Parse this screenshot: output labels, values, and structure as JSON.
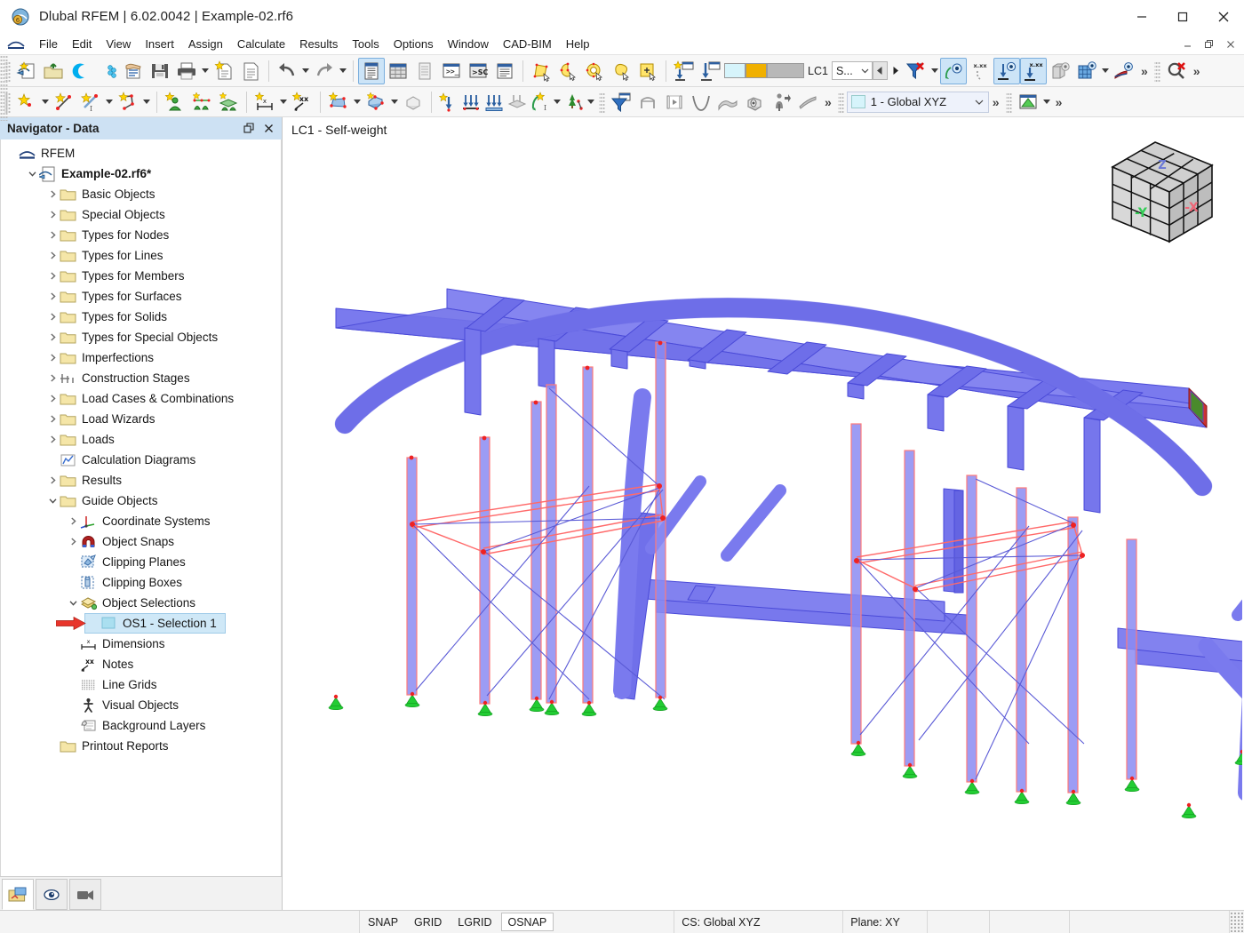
{
  "window": {
    "title": "Dlubal RFEM | 6.02.0042 | Example-02.rf6",
    "app_icon": "rfem-app-icon",
    "minimize": "minimize-icon",
    "maximize": "maximize-icon",
    "close": "close-icon"
  },
  "menubar": {
    "items": [
      {
        "label": "File"
      },
      {
        "label": "Edit"
      },
      {
        "label": "View"
      },
      {
        "label": "Insert"
      },
      {
        "label": "Assign"
      },
      {
        "label": "Calculate"
      },
      {
        "label": "Results"
      },
      {
        "label": "Tools"
      },
      {
        "label": "Options"
      },
      {
        "label": "Window"
      },
      {
        "label": "CAD-BIM"
      },
      {
        "label": "Help"
      }
    ]
  },
  "toolbar1": {
    "buttons": [
      {
        "name": "new-model-button",
        "icon": "new-model-icon"
      },
      {
        "name": "open-button",
        "icon": "open-folder-icon"
      },
      {
        "name": "dlubal-center-button",
        "icon": "dlubal-c-icon"
      },
      {
        "name": "model-library-button",
        "icon": "blue-cube-icon"
      },
      {
        "name": "model-info-button",
        "icon": "hand-list-icon"
      },
      {
        "name": "save-button",
        "icon": "floppy-save-icon"
      },
      {
        "name": "print-button",
        "icon": "printer-icon",
        "dropdown": true
      },
      {
        "name": "new-report-button",
        "icon": "new-document-star-icon"
      },
      {
        "name": "document-button",
        "icon": "document-icon"
      }
    ],
    "undo": {
      "name": "undo-button",
      "icon": "undo-arrow-icon",
      "dropdown": true
    },
    "redo": {
      "name": "redo-button",
      "icon": "redo-arrow-icon",
      "dropdown": true
    },
    "tables": [
      {
        "name": "navigator-table-button",
        "icon": "table-list-icon",
        "active": true
      },
      {
        "name": "spreadsheet-button",
        "icon": "grid-table-icon"
      },
      {
        "name": "printout-table-button",
        "icon": "printout-table-icon"
      },
      {
        "name": "console-button",
        "icon": "console-prompt-icon"
      },
      {
        "name": "script-button",
        "icon": "script-sc-icon"
      },
      {
        "name": "detail-table-button",
        "icon": "detail-table-icon"
      }
    ],
    "selection": [
      {
        "name": "select-objects-button",
        "icon": "select-polygon-icon"
      },
      {
        "name": "select-special-button",
        "icon": "select-lasso-icon"
      },
      {
        "name": "select-all-button",
        "icon": "select-circle-icon"
      },
      {
        "name": "deselect-button",
        "icon": "lasso-cursor-icon"
      },
      {
        "name": "add-to-selection-button",
        "icon": "plus-selection-icon"
      }
    ],
    "loads": [
      {
        "name": "new-load-case-button",
        "icon": "new-load-case-icon"
      },
      {
        "name": "load-import-button",
        "icon": "load-import-icon"
      }
    ],
    "lc_swatch1": "#d6f4fb",
    "lc_swatch2": "#f0b000",
    "lc_swatch3": "#b8b8b8",
    "lc_label": "LC1",
    "lc_combo_value": "S...",
    "prev_lc": "prev-load-case-arrow",
    "next_lc": "next-load-case-arrow",
    "view_tools": [
      {
        "name": "filter-off-button",
        "icon": "filter-red-x-icon",
        "dropdown": true
      },
      {
        "name": "show-numbering-button",
        "icon": "eye-numbering-icon",
        "active": true
      },
      {
        "name": "hide-values-button",
        "icon": "xxx-hidden-icon"
      },
      {
        "name": "show-supports-button",
        "icon": "eye-support-icon",
        "active": true
      },
      {
        "name": "show-support-values-button",
        "icon": "xxx-support-icon",
        "active": true
      },
      {
        "name": "show-solids-button",
        "icon": "eye-solid-icon"
      },
      {
        "name": "show-grid-button",
        "icon": "eye-grid-icon",
        "dropdown": true
      },
      {
        "name": "show-results-button",
        "icon": "eye-results-icon"
      }
    ],
    "overflow": "chevron-more-icon",
    "zoom_reset": {
      "name": "zoom-reset-button",
      "icon": "magnifier-red-x-icon"
    },
    "overflow2": "chevron-more-icon"
  },
  "toolbar2": {
    "group_nodes": [
      {
        "name": "new-node-button",
        "icon": "node-star-icon",
        "dropdown": true
      },
      {
        "name": "new-line-button",
        "icon": "line-star-icon"
      },
      {
        "name": "new-line-type-button",
        "icon": "line-type-star-icon",
        "dropdown": true
      },
      {
        "name": "new-polyline-button",
        "icon": "polyline-star-icon",
        "dropdown": true
      }
    ],
    "group_supports": [
      {
        "name": "new-nodal-support-button",
        "icon": "nodal-support-icon"
      },
      {
        "name": "new-line-support-button",
        "icon": "line-support-icon"
      },
      {
        "name": "new-surface-support-button",
        "icon": "surface-support-icon"
      }
    ],
    "group_dims": [
      {
        "name": "new-dimension-button",
        "icon": "dimension-x-icon",
        "dropdown": true
      },
      {
        "name": "new-note-button",
        "icon": "note-xx-icon"
      }
    ],
    "group_surfaces": [
      {
        "name": "new-surface-button",
        "icon": "surface-star-icon",
        "dropdown": true
      },
      {
        "name": "new-solid-button",
        "icon": "solid-star-icon",
        "dropdown": true
      },
      {
        "name": "new-opening-button",
        "icon": "opening-star-icon",
        "dropdown": true
      },
      {
        "name": "new-member-button",
        "icon": "member-star-icon",
        "dropdown": true
      },
      {
        "name": "new-block-button",
        "icon": "block-icon"
      }
    ],
    "group_loads": [
      {
        "name": "new-nodal-load-button",
        "icon": "nodal-load-icon"
      },
      {
        "name": "new-member-load-button",
        "icon": "member-load-icon"
      },
      {
        "name": "new-line-load-button",
        "icon": "line-load-icon"
      },
      {
        "name": "new-surface-load-button",
        "icon": "surface-load-icon"
      },
      {
        "name": "new-free-load-button",
        "icon": "free-load-icon",
        "dropdown": true
      },
      {
        "name": "new-imperfection-button",
        "icon": "imperfection-icon",
        "dropdown": true
      }
    ],
    "group_render": [
      {
        "name": "render-filter-button",
        "icon": "blue-funnel-window-icon"
      },
      {
        "name": "rendering-mode-button",
        "icon": "wireframe-icon"
      },
      {
        "name": "animation-button",
        "icon": "film-strip-icon"
      },
      {
        "name": "deformation-button",
        "icon": "deformation-curve-icon"
      },
      {
        "name": "surface-results-button",
        "icon": "surface-results-icon"
      },
      {
        "name": "solid-results-button",
        "icon": "solid-results-icon"
      },
      {
        "name": "support-reactions-button",
        "icon": "support-reaction-icon"
      },
      {
        "name": "slab-results-button",
        "icon": "slab-results-icon"
      }
    ],
    "overflow": "chevron-more-icon",
    "cs_swatch": "#d6f4fb",
    "cs_value": "1 - Global XYZ",
    "cs_dropdown": "chevron-down-icon",
    "overflow2": "chevron-more-icon",
    "graphic_button": {
      "name": "graphic-settings-button",
      "icon": "green-graphic-icon",
      "dropdown": true
    },
    "overflow3": "chevron-more-icon"
  },
  "navigator": {
    "title": "Navigator - Data",
    "undock_icon": "undock-icon",
    "close_icon": "close-icon",
    "tree": [
      {
        "label": "RFEM",
        "indent": 0,
        "twist": "none",
        "icon": "rfem-root-icon",
        "bold": false
      },
      {
        "label": "Example-02.rf6*",
        "indent": 1,
        "twist": "open",
        "icon": "model-file-icon",
        "bold": true
      },
      {
        "label": "Basic Objects",
        "indent": 2,
        "twist": "closed",
        "icon": "folder-icon"
      },
      {
        "label": "Special Objects",
        "indent": 2,
        "twist": "closed",
        "icon": "folder-icon"
      },
      {
        "label": "Types for Nodes",
        "indent": 2,
        "twist": "closed",
        "icon": "folder-icon"
      },
      {
        "label": "Types for Lines",
        "indent": 2,
        "twist": "closed",
        "icon": "folder-icon"
      },
      {
        "label": "Types for Members",
        "indent": 2,
        "twist": "closed",
        "icon": "folder-icon"
      },
      {
        "label": "Types for Surfaces",
        "indent": 2,
        "twist": "closed",
        "icon": "folder-icon"
      },
      {
        "label": "Types for Solids",
        "indent": 2,
        "twist": "closed",
        "icon": "folder-icon"
      },
      {
        "label": "Types for Special Objects",
        "indent": 2,
        "twist": "closed",
        "icon": "folder-icon"
      },
      {
        "label": "Imperfections",
        "indent": 2,
        "twist": "closed",
        "icon": "folder-icon"
      },
      {
        "label": "Construction Stages",
        "indent": 2,
        "twist": "closed",
        "icon": "construction-stages-icon"
      },
      {
        "label": "Load Cases & Combinations",
        "indent": 2,
        "twist": "closed",
        "icon": "folder-icon"
      },
      {
        "label": "Load Wizards",
        "indent": 2,
        "twist": "closed",
        "icon": "folder-icon"
      },
      {
        "label": "Loads",
        "indent": 2,
        "twist": "closed",
        "icon": "folder-icon"
      },
      {
        "label": "Calculation Diagrams",
        "indent": 2,
        "twist": "none",
        "icon": "calculation-diagram-icon"
      },
      {
        "label": "Results",
        "indent": 2,
        "twist": "closed",
        "icon": "folder-icon"
      },
      {
        "label": "Guide Objects",
        "indent": 2,
        "twist": "open",
        "icon": "folder-icon"
      },
      {
        "label": "Coordinate Systems",
        "indent": 3,
        "twist": "closed",
        "icon": "coordinate-system-icon"
      },
      {
        "label": "Object Snaps",
        "indent": 3,
        "twist": "closed",
        "icon": "magnet-icon"
      },
      {
        "label": "Clipping Planes",
        "indent": 3,
        "twist": "none",
        "icon": "clipping-plane-icon"
      },
      {
        "label": "Clipping Boxes",
        "indent": 3,
        "twist": "none",
        "icon": "clipping-box-icon"
      },
      {
        "label": "Object Selections",
        "indent": 3,
        "twist": "open",
        "icon": "object-selections-icon"
      },
      {
        "label": "OS1 - Selection 1",
        "indent": 4,
        "twist": "none",
        "icon": "selection-swatch-icon",
        "selected": true,
        "marker": "red-arrow-pointer"
      },
      {
        "label": "Dimensions",
        "indent": 3,
        "twist": "none",
        "icon": "dimension-icon"
      },
      {
        "label": "Notes",
        "indent": 3,
        "twist": "none",
        "icon": "note-icon"
      },
      {
        "label": "Line Grids",
        "indent": 3,
        "twist": "none",
        "icon": "line-grid-icon"
      },
      {
        "label": "Visual Objects",
        "indent": 3,
        "twist": "none",
        "icon": "visual-object-icon"
      },
      {
        "label": "Background Layers",
        "indent": 3,
        "twist": "none",
        "icon": "background-layer-icon"
      },
      {
        "label": "Printout Reports",
        "indent": 2,
        "twist": "none",
        "icon": "folder-icon"
      }
    ],
    "tabs": [
      {
        "name": "navigator-tab-data",
        "icon": "data-navigator-icon",
        "selected": true
      },
      {
        "name": "navigator-tab-display",
        "icon": "eye-display-icon",
        "selected": false
      },
      {
        "name": "navigator-tab-views",
        "icon": "video-camera-icon",
        "selected": false
      }
    ]
  },
  "viewport": {
    "load_case_label": "LC1 - Self-weight",
    "viewcube": {
      "name": "view-cube",
      "face_left": "-Y",
      "face_right": "-X",
      "face_top": "Z",
      "color_left": "#33cc55",
      "color_right": "#ee6677",
      "color_top": "#6a78d6"
    },
    "model": {
      "member_color": "#6a6ae8",
      "selected_member_color": "#ff8080",
      "support_color": "#22cc33",
      "node_color": "#ee2222"
    }
  },
  "statusbar": {
    "toggles": [
      {
        "label": "SNAP",
        "on": false
      },
      {
        "label": "GRID",
        "on": false
      },
      {
        "label": "LGRID",
        "on": false
      },
      {
        "label": "OSNAP",
        "on": true
      }
    ],
    "cs": "CS: Global XYZ",
    "plane": "Plane: XY"
  }
}
